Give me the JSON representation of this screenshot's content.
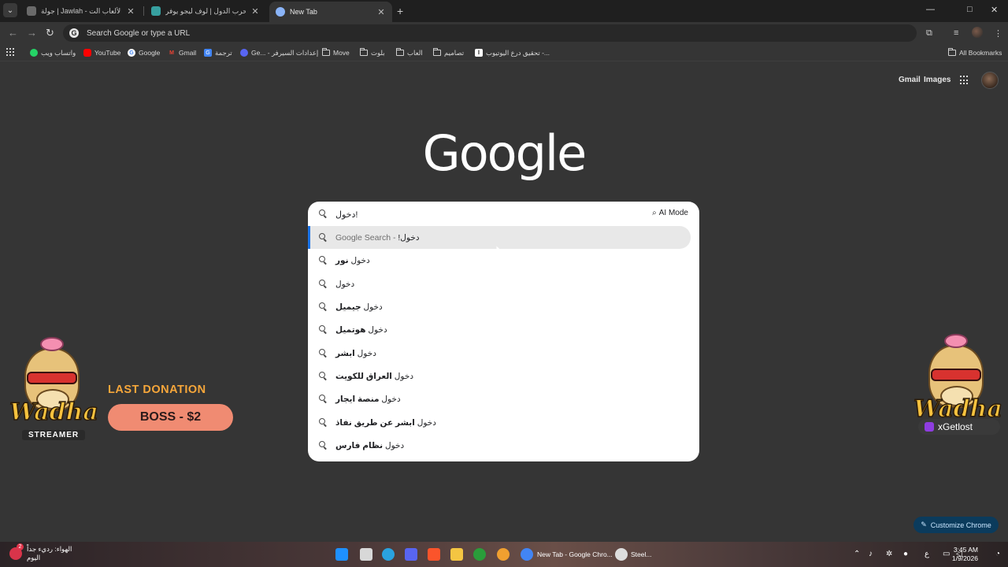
{
  "tabs": [
    {
      "title": "جولة | Jawlah - منصة الألعاب الت...",
      "favicon_color": "#6a6a6a"
    },
    {
      "title": "لعبة حرب الدول | لوف ليجو يوفر...",
      "favicon_color": "#37a0a0"
    },
    {
      "title": "New Tab",
      "favicon_color": "#8ab4f8"
    }
  ],
  "tab_search_label": "⌄",
  "omnibox": {
    "text": "Search Google or type a URL",
    "icon": "G"
  },
  "bookmarks": [
    {
      "label": "واتساب ويب",
      "icon": "whatsapp-icon",
      "color": "#25d366"
    },
    {
      "label": "YouTube",
      "icon": "youtube-icon",
      "color": "#ff0000"
    },
    {
      "label": "Google",
      "icon": "google-icon",
      "color": "#ffffff"
    },
    {
      "label": "Gmail",
      "icon": "gmail-icon",
      "color": "#ea4335"
    },
    {
      "label": "ترجمة",
      "icon": "translate-icon",
      "color": "#4285f4"
    },
    {
      "label": "Ge... - إعدادات السيرفر",
      "icon": "discord-icon",
      "color": "#5865f2"
    },
    {
      "label": "Move",
      "icon": "folder-icon"
    },
    {
      "label": "بلوت",
      "icon": "folder-icon"
    },
    {
      "label": "العاب",
      "icon": "folder-icon"
    },
    {
      "label": "تصاميم",
      "icon": "folder-icon"
    },
    {
      "label": "تحقيق درع اليوتيوب -...",
      "icon": "logo-icon",
      "color": "#ffffff"
    }
  ],
  "all_bookmarks": "All Bookmarks",
  "header_links": {
    "gmail": "Gmail",
    "images": "Images"
  },
  "logo": "Google",
  "search": {
    "query": "دخول!",
    "ai_mode": "AI Mode",
    "suggestions": [
      {
        "prefix": "دخول!",
        "bold": "",
        "suffix": " - Google Search",
        "highlighted": true
      },
      {
        "prefix": "دخول ",
        "bold": "نور",
        "suffix": ""
      },
      {
        "prefix": "دخول",
        "bold": "",
        "suffix": ""
      },
      {
        "prefix": "دخول ",
        "bold": "جيميل",
        "suffix": ""
      },
      {
        "prefix": "دخول ",
        "bold": "هوتميل",
        "suffix": ""
      },
      {
        "prefix": "دخول ",
        "bold": "ابشر",
        "suffix": ""
      },
      {
        "prefix": "دخول ",
        "bold": "العراق للكويت",
        "suffix": ""
      },
      {
        "prefix": "دخول ",
        "bold": "منصة ايجار",
        "suffix": ""
      },
      {
        "prefix": "دخول ",
        "bold": "ابشر عن طريق نفاذ",
        "suffix": ""
      },
      {
        "prefix": "دخول ",
        "bold": "نظام فارس",
        "suffix": ""
      }
    ]
  },
  "overlay": {
    "left_brand": "Wadha",
    "left_tag": "STREAMER",
    "donation_title": "LAST DONATION",
    "donation_value": "BOSS - $2",
    "right_brand": "Wadha",
    "right_tag": "xGetlost"
  },
  "customize": "Customize Chrome",
  "taskbar": {
    "weather_line1": "الهواء: رديء جداً",
    "weather_line2": "اليوم",
    "weather_badge": "2",
    "chrome_label": "New Tab - Google Chro...",
    "steam_label": "Steel...",
    "time": "3:45 AM",
    "date": "1/9/2026",
    "lang": "ع"
  }
}
